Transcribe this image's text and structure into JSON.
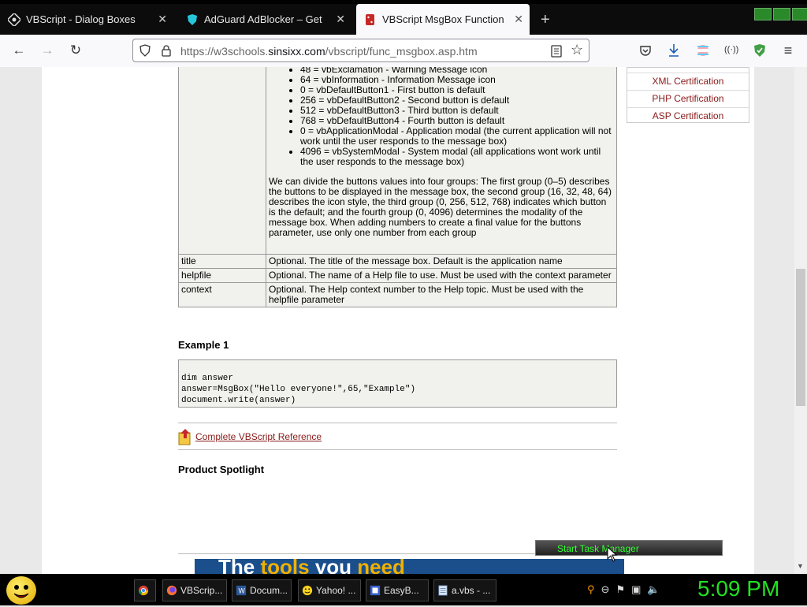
{
  "tabs": [
    {
      "label": "VBScript - Dialog Boxes"
    },
    {
      "label": "AdGuard AdBlocker – Get this E"
    },
    {
      "label": "VBScript MsgBox Function"
    }
  ],
  "nav": {
    "url_host": "https://w3schools.",
    "url_domain": "sinsixx.com",
    "url_path": "/vbscript/func_msgbox.asp.htm"
  },
  "table": {
    "bullets": [
      "48 = vbExclamation - Warning Message icon",
      "64 = vbInformation - Information Message icon",
      "0 = vbDefaultButton1 - First button is default",
      "256 = vbDefaultButton2 - Second button is default",
      "512 = vbDefaultButton3 - Third button is default",
      "768 = vbDefaultButton4 - Fourth button is default",
      "0 = vbApplicationModal - Application modal (the current application will not work until the user responds to the message box)",
      "4096 = vbSystemModal - System modal (all applications wont work until the user responds to the message box)"
    ],
    "groups_text": "We can divide the buttons values into four groups: The first group  (0–5) describes the buttons to be displayed in the message box, the second group (16, 32, 48, 64) describes the icon style, the third group (0, 256, 512, 768) indicates which button is the default; and the fourth group (0, 4096) determines the modality of the message box. When adding numbers to create a final value for the buttons parameter, use only one number from each group",
    "rows": [
      {
        "param": "title",
        "desc": "Optional. The title of the message box. Default is the application name"
      },
      {
        "param": "helpfile",
        "desc": "Optional. The name of a Help file to use. Must be used with the context parameter"
      },
      {
        "param": "context",
        "desc": "Optional. The Help context number to the Help topic. Must be used with the helpfile parameter"
      }
    ]
  },
  "example_heading": "Example 1",
  "code": "dim answer\nanswer=MsgBox(\"Hello everyone!\",65,\"Example\")\ndocument.write(answer)",
  "reference_link": "Complete VBScript Reference",
  "spotlight_heading": "Product Spotlight",
  "sidebar": {
    "items": [
      "XML Certification",
      "PHP Certification",
      "ASP Certification"
    ]
  },
  "banner": {
    "part1": "The ",
    "part2": "tools",
    "part3": " you ",
    "part4": "need"
  },
  "task_manager_label": "Start Task Manager",
  "taskbar": {
    "items": [
      "VBScrip...",
      "Docum...",
      "Yahoo! ...",
      "EasyB...",
      "a.vbs - ..."
    ],
    "clock": "5:09 PM"
  }
}
